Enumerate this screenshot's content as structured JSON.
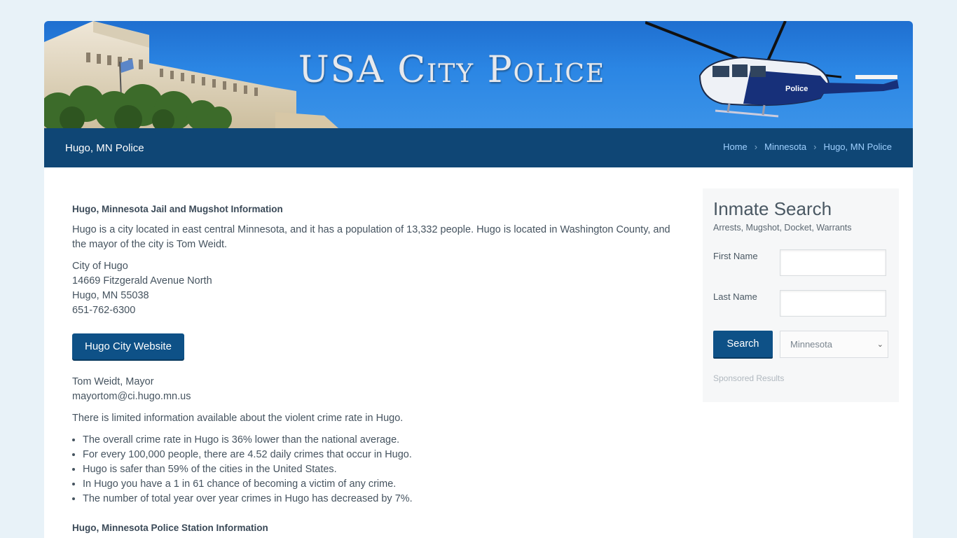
{
  "banner": {
    "title": "USA City Police",
    "heli_text": "Police"
  },
  "titlebar": {
    "page_title": "Hugo, MN Police",
    "breadcrumbs": [
      "Home",
      "Minnesota",
      "Hugo, MN Police"
    ]
  },
  "main": {
    "heading": "Hugo, Minnesota Jail and Mugshot Information",
    "intro": "Hugo is a city located in east central Minnesota, and it has a population of 13,332 people. Hugo is located in Washington County, and the mayor of the city is Tom Weidt.",
    "address": [
      "City of Hugo",
      "14669 Fitzgerald Avenue North",
      "Hugo, MN 55038",
      "651-762-6300"
    ],
    "website_button": "Hugo City Website",
    "mayor": [
      "Tom Weidt, Mayor",
      "mayortom@ci.hugo.mn.us"
    ],
    "crime_intro": "There is limited information available about the violent crime rate in Hugo.",
    "crime_facts": [
      "The overall crime rate in Hugo is 36% lower than the national average.",
      "For every 100,000 people, there are 4.52 daily crimes that occur in Hugo.",
      "Hugo is safer than 59% of the cities in the United States.",
      "In Hugo you have a 1 in 61 chance of becoming a victim of any crime.",
      "The number of total year over year crimes in Hugo has decreased by 7%."
    ],
    "station_heading": "Hugo, Minnesota Police Station Information"
  },
  "sidebar": {
    "title": "Inmate Search",
    "subtitle": "Arrests, Mugshot, Docket, Warrants",
    "first_name_label": "First Name",
    "last_name_label": "Last Name",
    "search_button": "Search",
    "state_selected": "Minnesota",
    "sponsored": "Sponsored Results"
  }
}
